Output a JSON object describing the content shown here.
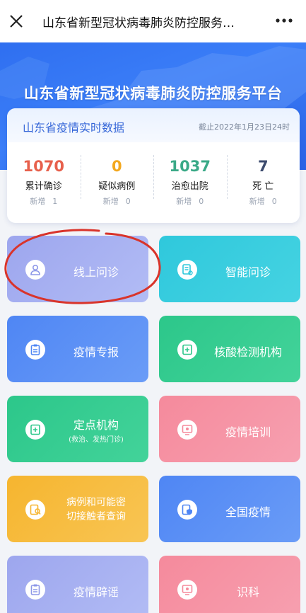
{
  "topbar": {
    "title": "山东省新型冠状病毒肺炎防控服务…",
    "close_icon": "close-icon",
    "more_icon": "more-icon"
  },
  "banner": {
    "heading": "山东省新型冠状病毒肺炎防控服务平台"
  },
  "stats": {
    "label": "山东省疫情实时数据",
    "date": "截止2022年1月23日24时",
    "new_label": "新增",
    "items": [
      {
        "value": "1070",
        "name": "累计确诊",
        "new": "1",
        "color": "#e7604c"
      },
      {
        "value": "0",
        "name": "疑似病例",
        "new": "0",
        "color": "#f3a81f"
      },
      {
        "value": "1037",
        "name": "治愈出院",
        "new": "0",
        "color": "#3aa987"
      },
      {
        "value": "7",
        "name": "死 亡",
        "new": "0",
        "color": "#3c4b6e"
      }
    ]
  },
  "tiles": [
    {
      "label": "线上问诊",
      "icon": "doctor-icon",
      "color": "#9da6ee"
    },
    {
      "label": "智能问诊",
      "icon": "report-icon",
      "color": "#2fc8dc"
    },
    {
      "label": "疫情专报",
      "icon": "clipboard-icon",
      "color": "#4f86f4"
    },
    {
      "label": "核酸检测机构",
      "icon": "medical-kit-icon",
      "color": "#2cc78a"
    },
    {
      "label": "定点机构",
      "sub": "(救治、发热门诊)",
      "icon": "medical-kit-icon",
      "color": "#2cc78a"
    },
    {
      "label": "疫情培训",
      "icon": "training-icon",
      "color": "#f58a9c"
    },
    {
      "label": "病例和可能密切接触者查询",
      "line1": "病例和可能密",
      "line2": "切接触者查询",
      "icon": "search-doc-icon",
      "color": "#f6b52f"
    },
    {
      "label": "全国疫情",
      "icon": "shield-doc-icon",
      "color": "#4f86f4"
    },
    {
      "label": "疫情辟谣",
      "icon": "clipboard-icon",
      "color": "#9da6ee"
    },
    {
      "label": "识科",
      "icon": "training-icon",
      "color": "#f58a9c"
    }
  ],
  "annotation": {
    "color": "#d9342b"
  }
}
